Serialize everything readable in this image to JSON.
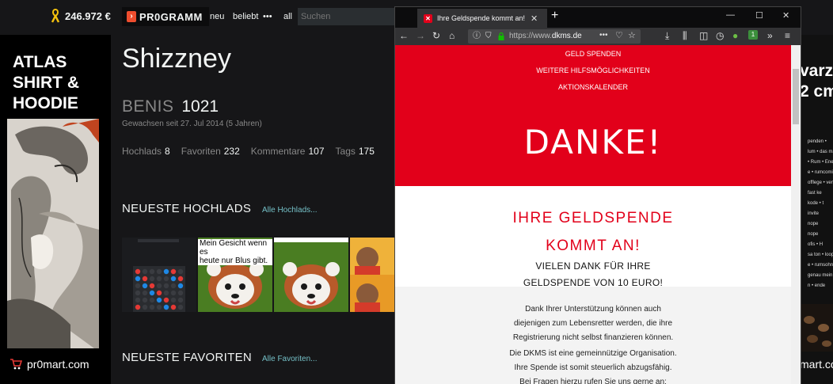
{
  "site": {
    "benis_total": "246.972 €",
    "logo_text": "PR0GRAMM",
    "nav": {
      "new": "neu",
      "popular": "beliebt",
      "more": "•••",
      "all": "all"
    },
    "search_placeholder": "Suchen"
  },
  "ad_left": {
    "title": "ATLAS\nSHIRT &\nHOODIE",
    "shop": "pr0mart.com"
  },
  "profile": {
    "name": "Shizzney",
    "benis_label": "BENIS",
    "benis_value": "1021",
    "since": "Gewachsen seit 27. Jul 2014 (5 Jahren)",
    "stats": [
      {
        "label": "Hochlads",
        "value": "8"
      },
      {
        "label": "Favoriten",
        "value": "232"
      },
      {
        "label": "Kommentare",
        "value": "107"
      },
      {
        "label": "Tags",
        "value": "175"
      }
    ]
  },
  "sections": {
    "uploads_title": "NEUESTE HOCHLADS",
    "uploads_link": "Alle Hochlads...",
    "favorites_title": "NEUESTE FAVORITEN",
    "favorites_link": "Alle Favoriten..."
  },
  "thumb_caption": "Mein Gesicht wenn es\nheute nur Blus gibt.",
  "browser": {
    "tab_title": "Ihre Geldspende kommt an!",
    "new_tab": "+",
    "url_prefix": "https://www.",
    "url_host": "dkms.de",
    "url_more": "•••",
    "badge": "1"
  },
  "page": {
    "menu": [
      "GELD SPENDEN",
      "WEITERE HILFSMÖGLICHKEITEN",
      "AKTIONSKALENDER"
    ],
    "hero": "DANKE!",
    "title_line1": "IHRE GELDSPENDE",
    "title_line2": "KOMMT AN!",
    "thanks_line1": "VIELEN DANK FÜR IHRE",
    "thanks_line2": "GELDSPENDE VON 10 EURO!",
    "body": [
      "Dank Ihrer Unterstützung können auch",
      "diejenigen zum Lebensretter werden, die ihre",
      "Registrierung nicht selbst finanzieren können.",
      "Die DKMS ist eine gemeinnützige Organisation.",
      "Ihre Spende ist somit steuerlich abzugsfähig.",
      "Bei Fragen hierzu rufen Sie uns gerne an:"
    ]
  },
  "ad_right": {
    "line1": "varz",
    "line2": "2 cm",
    "small": [
      "penden •",
      "lum • das mäch",
      "• Rum • Energie",
      "e • rumcomic",
      "offlege • ventil",
      "fast ke",
      "kode • t",
      "invite",
      "nope",
      "nope",
      "ofis • H",
      "sa ton • loop",
      "e • rumsohn",
      "genau mein",
      "n • ende"
    ],
    "shop": "mart.com"
  },
  "colors": {
    "dkms_red": "#e2001a",
    "pr0_orange": "#ee4d2e",
    "link_teal": "#75c0c7"
  }
}
